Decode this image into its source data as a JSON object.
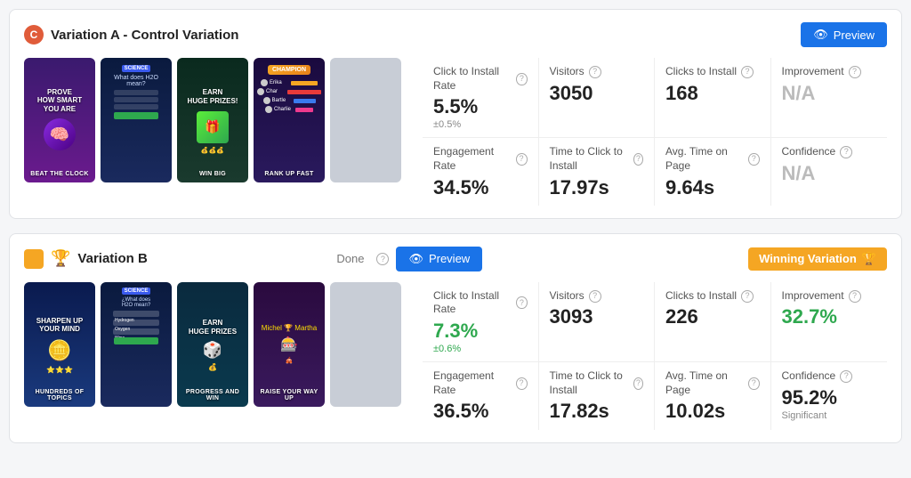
{
  "variationA": {
    "badge": "C",
    "title": "Variation A - Control Variation",
    "preview_label": "Preview",
    "stats": {
      "click_to_install_rate_label": "Click to Install Rate",
      "click_to_install_rate_value": "5.5%",
      "click_to_install_rate_sub": "±0.5%",
      "visitors_label": "Visitors",
      "visitors_value": "3050",
      "clicks_to_install_label": "Clicks to Install",
      "clicks_to_install_value": "168",
      "improvement_label": "Improvement",
      "improvement_value": "N/A",
      "engagement_rate_label": "Engagement Rate",
      "engagement_rate_value": "34.5%",
      "time_to_click_label": "Time to Click to Install",
      "time_to_click_value": "17.97s",
      "avg_time_label": "Avg. Time on Page",
      "avg_time_value": "9.64s",
      "confidence_label": "Confidence",
      "confidence_value": "N/A"
    },
    "thumbs": [
      {
        "label": "Beat the Clock",
        "top": "PROVE HOW SMART YOU ARE"
      },
      {
        "label": "",
        "top": "SCIENCE",
        "type": "quiz"
      },
      {
        "label": "WIN BIG",
        "top": "Earn HUGE PRIZES!"
      },
      {
        "label": "RANK UP FAST",
        "top": "CHAMPION"
      }
    ]
  },
  "variationB": {
    "title": "Variation B",
    "done_label": "Done",
    "preview_label": "Preview",
    "winning_label": "Winning Variation",
    "stats": {
      "click_to_install_rate_label": "Click to Install Rate",
      "click_to_install_rate_value": "7.3%",
      "click_to_install_rate_sub": "±0.6%",
      "visitors_label": "Visitors",
      "visitors_value": "3093",
      "clicks_to_install_label": "Clicks to Install",
      "clicks_to_install_value": "226",
      "improvement_label": "Improvement",
      "improvement_value": "32.7%",
      "engagement_rate_label": "Engagement Rate",
      "engagement_rate_value": "36.5%",
      "time_to_click_label": "Time to Click to Install",
      "time_to_click_value": "17.82s",
      "avg_time_label": "Avg. Time on Page",
      "avg_time_value": "10.02s",
      "confidence_label": "Confidence",
      "confidence_value": "95.2%",
      "confidence_sub": "Significant"
    },
    "thumbs": [
      {
        "label": "HUNDREDS OF TOPICS",
        "top": "SHARPEN UP YOUR MIND"
      },
      {
        "label": "",
        "top": "¿What does H2O mean?",
        "type": "quiz"
      },
      {
        "label": "PROGRESS AND WIN",
        "top": "Earn HUGE PRIZES"
      },
      {
        "label": "RAISE YOUR WAY UP",
        "top": ""
      }
    ]
  }
}
